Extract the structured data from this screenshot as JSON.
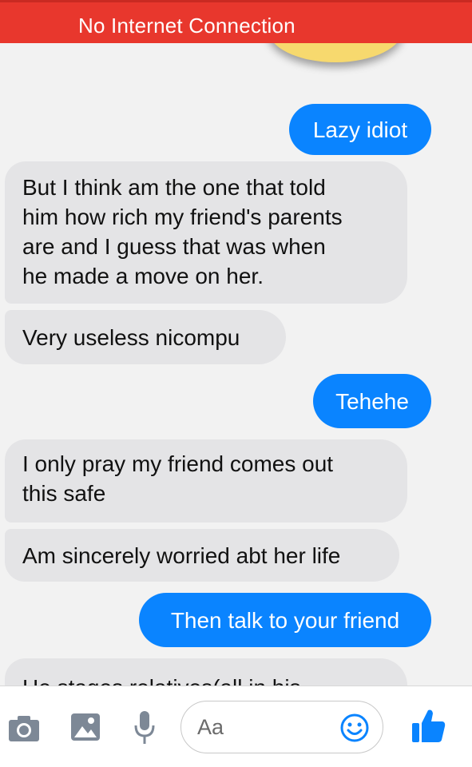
{
  "status_banner": {
    "text": "No Internet Connection"
  },
  "messages": [
    {
      "direction": "outgoing",
      "text": "Lazy idiot"
    },
    {
      "direction": "incoming",
      "lines": [
        "But I think am the one that told",
        "him how rich my friend's parents",
        "are and I guess that was when",
        "he made a move on her."
      ]
    },
    {
      "direction": "incoming",
      "text": "Very useless nicompu"
    },
    {
      "direction": "outgoing",
      "text": "Tehehe"
    },
    {
      "direction": "incoming",
      "lines": [
        "I only pray my friend comes out",
        "this safe"
      ]
    },
    {
      "direction": "incoming",
      "text": "Am sincerely worried abt her life"
    },
    {
      "direction": "outgoing",
      "text": "Then talk to your friend"
    },
    {
      "direction": "incoming",
      "text": "He stages relatives(all in his"
    }
  ],
  "composer": {
    "placeholder": "Aa",
    "icons": [
      "camera-icon",
      "image-icon",
      "microphone-icon",
      "emoji-icon",
      "thumbs-up-icon"
    ],
    "accent_color": "#0a84ff"
  },
  "colors": {
    "banner": "#e8372d",
    "outgoing_bubble": "#0a84ff",
    "incoming_bubble": "#e4e4e6",
    "background": "#f2f2f2"
  }
}
